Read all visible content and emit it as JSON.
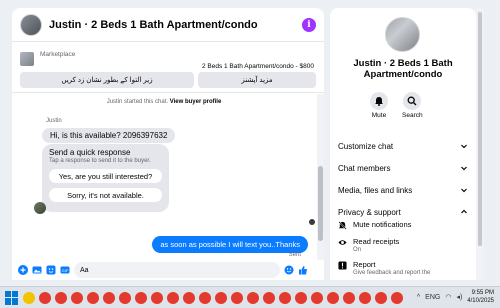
{
  "chat": {
    "title": "Justin · 2 Beds 1 Bath Apartment/condo",
    "marketplace_label": "Marketplace",
    "listing_price": "2 Beds 1 Bath Apartment/condo - $800",
    "btn_mark_sold": "زیر التوا کے بطور نشان زد کریں",
    "btn_more": "مزید آپشنز",
    "system_line_prefix": "Justin started this chat.",
    "system_line_link": "View buyer profile",
    "sender_name": "Justin",
    "incoming_message": "Hi, is this available? 2096397632",
    "quick_title": "Send a quick response",
    "quick_subtitle": "Tap a response to send it to the buyer.",
    "quick_replies": [
      "Yes, are you still interested?",
      "Sorry, it's not available."
    ],
    "outgoing_message": "as soon as possible I will text you..Thanks",
    "sent_status": "Sent",
    "input_value": "Aa"
  },
  "side": {
    "title": "Justin · 2 Beds 1 Bath Apartment/condo",
    "actions": [
      {
        "label": "Mute",
        "icon": "bell-icon"
      },
      {
        "label": "Search",
        "icon": "search-icon"
      }
    ],
    "sections": [
      "Customize chat",
      "Chat members",
      "Media, files and links",
      "Privacy & support"
    ],
    "privacy_options": [
      {
        "label": "Mute notifications",
        "sub": "",
        "icon": "bell-off-icon"
      },
      {
        "label": "Read receipts",
        "sub": "On",
        "icon": "eye-icon"
      },
      {
        "label": "Report",
        "sub": "Give feedback and report the",
        "icon": "report-icon"
      }
    ]
  },
  "taskbar": {
    "time": "9:55 PM",
    "date": "4/10/2025",
    "tray_lang": "ENG"
  },
  "colors": {
    "accent_blue": "#0a7cff",
    "info_purple": "#a033ff",
    "bubble_gray": "#e4e6eb"
  }
}
